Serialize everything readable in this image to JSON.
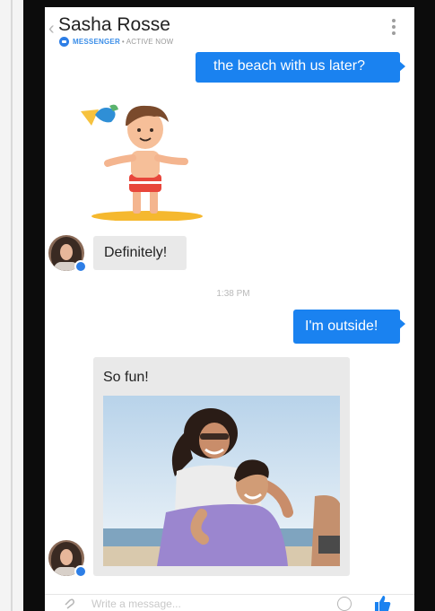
{
  "header": {
    "contact_name": "Sasha Rosse",
    "status_app": "MESSENGER",
    "status_separator": "•",
    "status_active": "ACTIVE NOW"
  },
  "messages": [
    {
      "direction": "outgoing",
      "text": "the beach with us later?"
    },
    {
      "direction": "incoming",
      "type": "sticker",
      "sticker": "surfer-sticker"
    },
    {
      "direction": "incoming",
      "text": "Definitely!"
    },
    {
      "direction": "outgoing",
      "text": "I'm outside!"
    },
    {
      "direction": "incoming",
      "text": "So fun!",
      "attachment": "beach-photo"
    }
  ],
  "timestamp": "1:38 PM",
  "composer": {
    "placeholder": "Write a message..."
  },
  "colors": {
    "accent": "#1a82f0",
    "incoming_bubble": "#e9e9e9",
    "bezel": "#0c0c0c"
  },
  "icons": [
    "back-chevron-icon",
    "messenger-icon",
    "more-vert-icon",
    "attach-icon",
    "emoji-icon",
    "like-thumb-icon"
  ]
}
